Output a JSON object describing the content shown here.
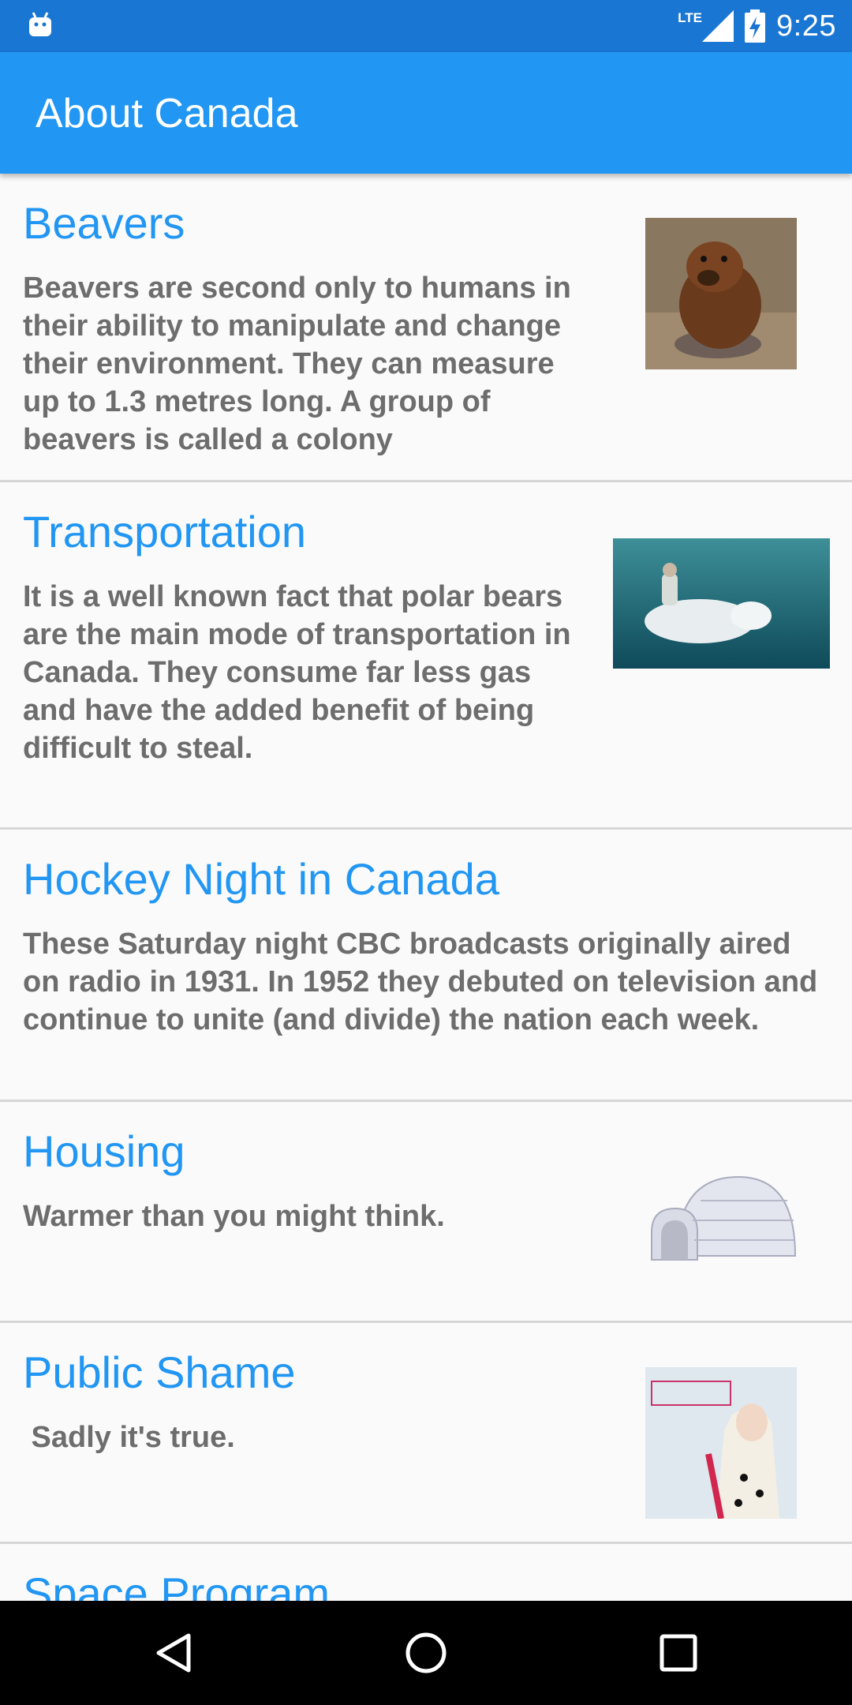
{
  "status_bar": {
    "time": "9:25",
    "network": "LTE",
    "icons": [
      "android-debug-icon",
      "signal-icon",
      "battery-charging-icon"
    ]
  },
  "app_bar": {
    "title": "About Canada"
  },
  "colors": {
    "status_bar": "#1976d2",
    "app_bar": "#2196f3",
    "heading": "#2196f3",
    "body_text": "#6d6d6d",
    "divider": "#d6d6d6",
    "background": "#fafafa",
    "nav_bar": "#000000"
  },
  "items": [
    {
      "title": "Beavers",
      "body": "Beavers are second only to humans in their ability to manipulate and change their environment. They can measure up to 1.3 metres long. A group of beavers is called a colony",
      "image": "beaver-photo"
    },
    {
      "title": "Transportation",
      "body": "It is a well known fact that polar bears are the main mode of transportation in Canada. They consume far less gas and have the added benefit of being difficult to steal.",
      "image": "polar-bear-rider-photo"
    },
    {
      "title": "Hockey Night in Canada",
      "body": "These Saturday night CBC broadcasts originally aired on radio in 1931. In 1952 they debuted on television and continue to unite (and divide) the nation each week."
    },
    {
      "title": "Housing",
      "body": "Warmer than you might think.",
      "image": "igloo-illustration"
    },
    {
      "title": "Public Shame",
      "body": " Sadly it's true.",
      "image": "album-cover-photo"
    },
    {
      "title": "Space Program"
    }
  ],
  "nav_bar": {
    "buttons": [
      "back-icon",
      "home-icon",
      "recents-icon"
    ]
  }
}
